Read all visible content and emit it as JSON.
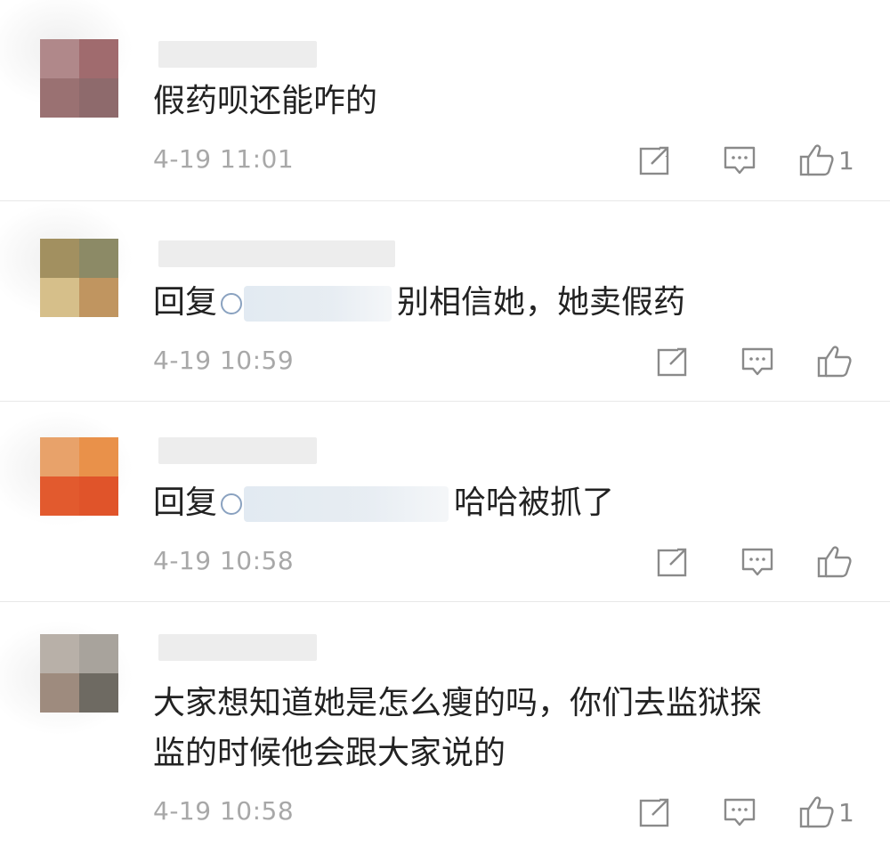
{
  "comments": [
    {
      "text": "假药呗还能咋的",
      "time": "4-19 11:01",
      "likes": "1",
      "avatar_colors": [
        "#b0888a",
        "#a06b6e",
        "#9a7172",
        "#8e6a6c"
      ]
    },
    {
      "reply_prefix": "回复",
      "text": "别相信她，她卖假药",
      "time": "4-19 10:59",
      "likes": "",
      "avatar_colors": [
        "#a29060",
        "#8c8a66",
        "#d6bf8a",
        "#c09560"
      ]
    },
    {
      "reply_prefix": "回复",
      "text": "哈哈被抓了",
      "time": "4-19 10:58",
      "likes": "",
      "avatar_colors": [
        "#e8a26a",
        "#e9914a",
        "#e25a2e",
        "#e0542a"
      ]
    },
    {
      "text_line1": "大家想知道她是怎么瘦的吗，你们去监狱探",
      "text_line2": "监的时候他会跟大家说的",
      "time": "4-19 10:58",
      "likes": "1",
      "avatar_colors": [
        "#b8b0a8",
        "#a8a39c",
        "#9e8b7e",
        "#6e6a62"
      ]
    }
  ],
  "icons": {
    "share": "share-icon",
    "comment": "comment-icon",
    "like": "thumbs-up-icon"
  },
  "colors": {
    "text": "#222222",
    "meta": "#a8a8a8",
    "icon": "#8a8a8a",
    "divider": "#e8e8e8"
  }
}
